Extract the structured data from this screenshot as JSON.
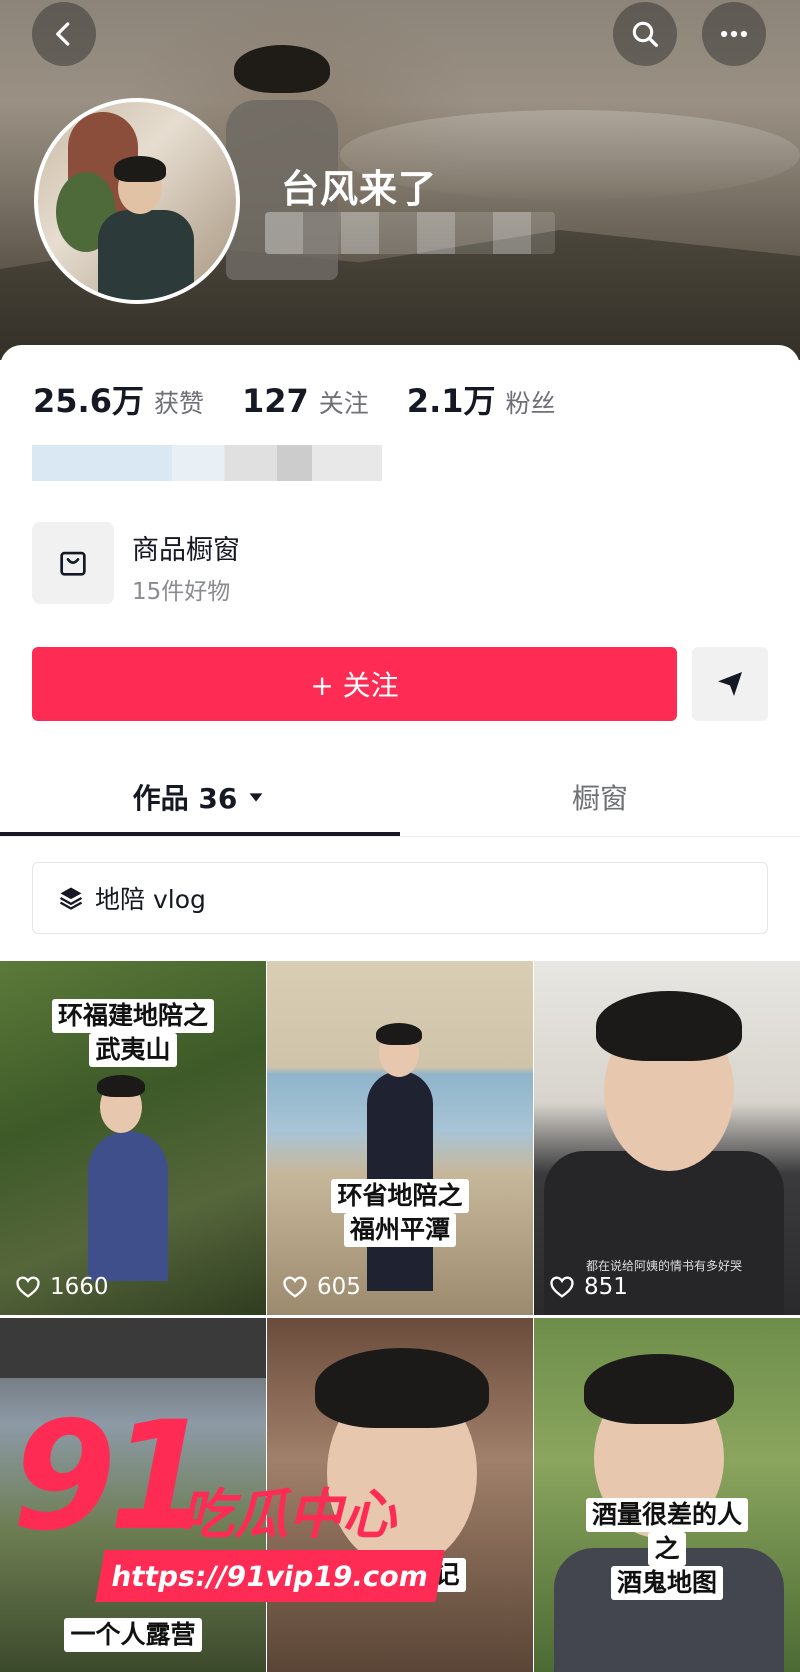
{
  "profile": {
    "name": "台风来了",
    "stats": [
      {
        "value": "25.6万",
        "label": "获赞"
      },
      {
        "value": "127",
        "label": "关注"
      },
      {
        "value": "2.1万",
        "label": "粉丝"
      }
    ]
  },
  "shop": {
    "title": "商品橱窗",
    "subtitle": "15件好物"
  },
  "actions": {
    "follow_label": "+ 关注"
  },
  "tabs": {
    "works_label": "作品 36",
    "window_label": "橱窗"
  },
  "collection": {
    "label": "地陪 vlog"
  },
  "videos": [
    {
      "caption_line1": "环福建地陪之",
      "caption_line2": "武夷山",
      "likes": "1660"
    },
    {
      "caption_line1": "环省地陪之",
      "caption_line2": "福州平潭",
      "likes": "605"
    },
    {
      "subtitle": "都在说给阿姨的情书有多好哭",
      "likes": "851"
    },
    {
      "caption_line1": "一个人露营"
    },
    {
      "caption_line1": "记"
    },
    {
      "caption_line1": "酒量很差的人",
      "caption_line2": "之",
      "caption_line3": "酒鬼地图"
    }
  ],
  "watermark": {
    "number": "91",
    "text": "吃瓜中心",
    "url": "https://91vip19.com"
  },
  "colors": {
    "accent": "#fe2c55",
    "text_primary": "#161823",
    "text_secondary": "#6f7076"
  }
}
